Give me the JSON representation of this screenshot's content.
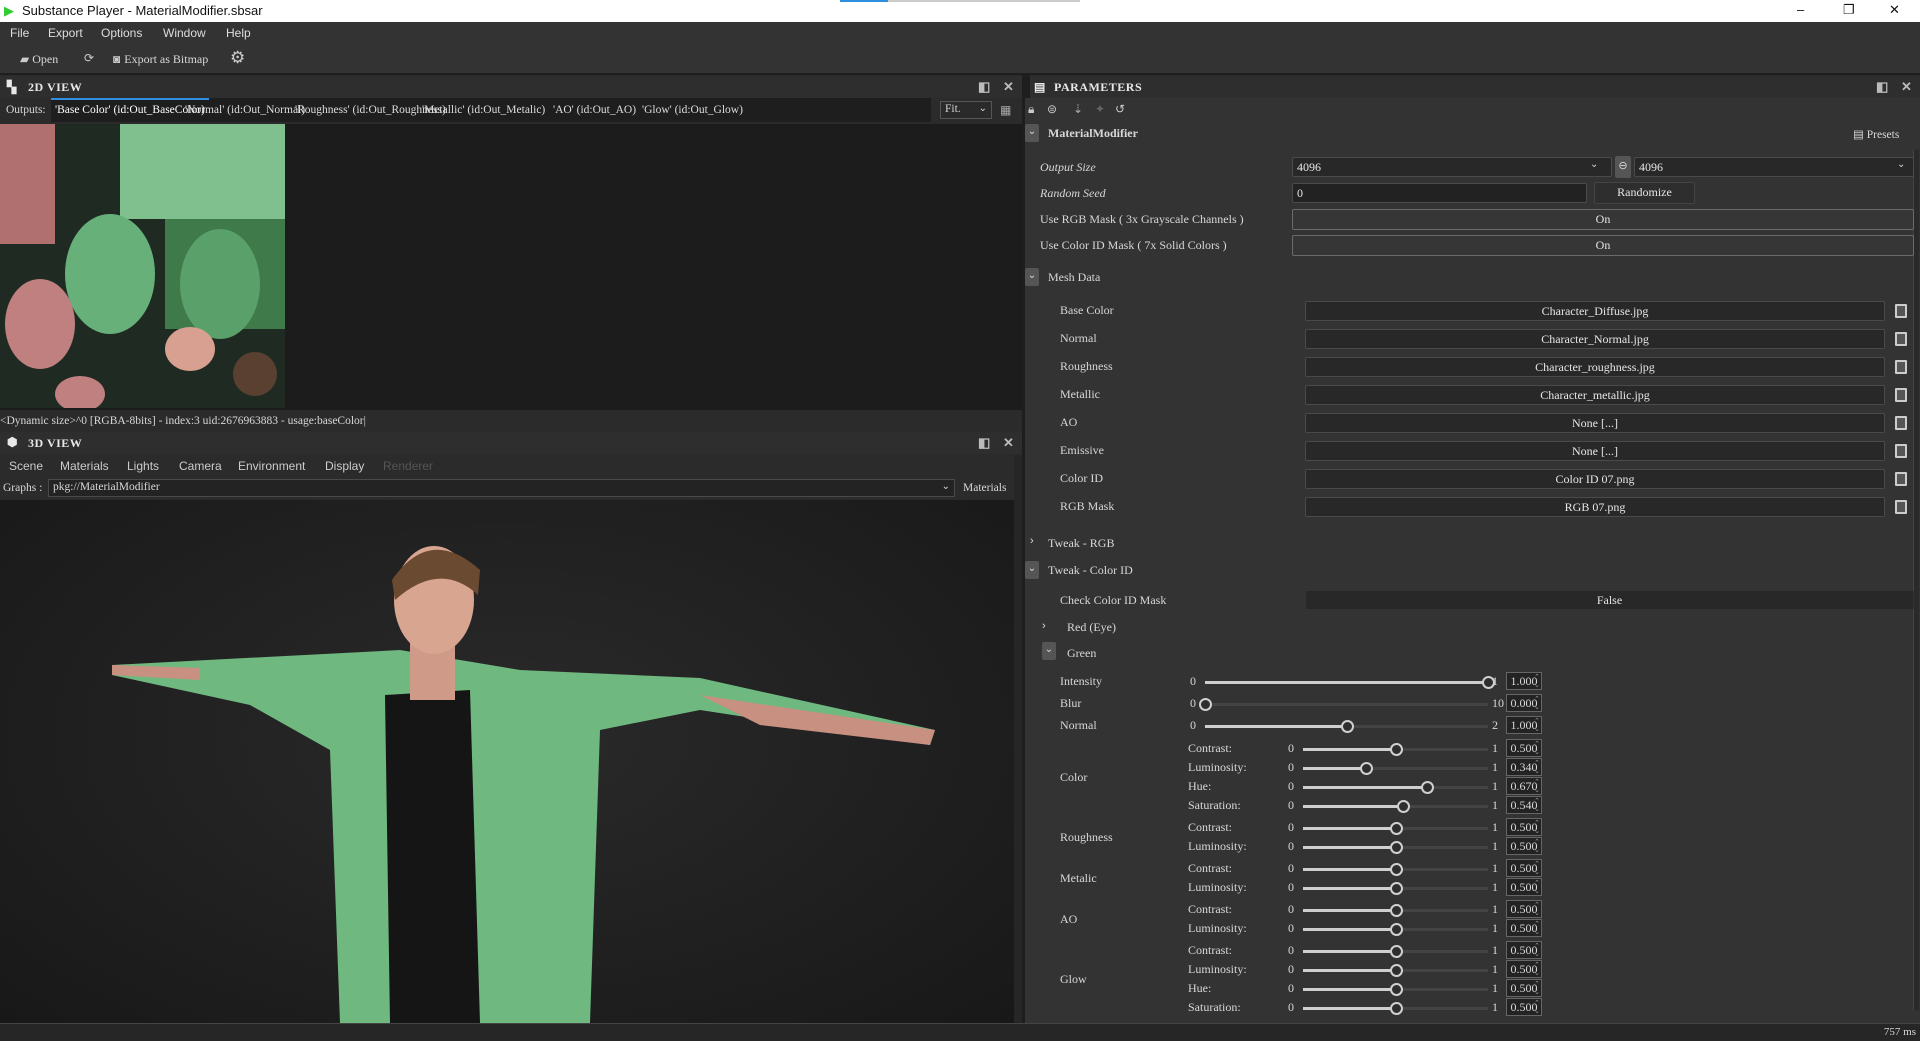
{
  "window": {
    "title": "Substance Player - MaterialModifier.sbsar",
    "minimize": "–",
    "maximize": "❐",
    "close": "✕"
  },
  "menu": [
    "File",
    "Export",
    "Options",
    "Window",
    "Help"
  ],
  "toolbar": {
    "open": "Open",
    "export": "Export as Bitmap"
  },
  "view2d": {
    "title": "2D VIEW",
    "outputs_label": "Outputs:",
    "tabs": [
      "'Base Color' (id:Out_BaseColor)",
      "'Normal' (id:Out_Normal)",
      "'Roughness' (id:Out_Roughness)",
      "'Metallic' (id:Out_Metalic)",
      "'AO' (id:Out_AO)",
      "'Glow' (id:Out_Glow)"
    ],
    "active_tab": 0,
    "zoom": "Fit.",
    "status": "<Dynamic size>^0 [RGBA-8bits] - index:3 uid:2676963883 - usage:baseColor|"
  },
  "view3d": {
    "title": "3D VIEW",
    "tabs": [
      "Scene",
      "Materials",
      "Lights",
      "Camera",
      "Environment",
      "Display",
      "Renderer"
    ],
    "graphs_label": "Graphs :",
    "graph": "pkg://MaterialModifier",
    "materials": "Materials"
  },
  "status": {
    "time": "757 ms"
  },
  "params": {
    "title": "PARAMETERS",
    "graph": "MaterialModifier",
    "presets": "Presets",
    "output_size_label": "Output Size",
    "output_w": "4096",
    "output_h": "4096",
    "seed_label": "Random Seed",
    "seed": "0",
    "randomize": "Randomize",
    "rgb_mask_label": "Use RGB Mask ( 3x Grayscale Channels )",
    "rgb_mask": "On",
    "colorid_mask_label": "Use Color ID Mask ( 7x Solid Colors )",
    "colorid_mask": "On",
    "mesh_group": "Mesh Data",
    "mesh": [
      {
        "label": "Base Color",
        "value": "Character_Diffuse.jpg"
      },
      {
        "label": "Normal",
        "value": "Character_Normal.jpg"
      },
      {
        "label": "Roughness",
        "value": "Character_roughness.jpg"
      },
      {
        "label": "Metallic",
        "value": "Character_metallic.jpg"
      },
      {
        "label": "AO",
        "value": "None [...]"
      },
      {
        "label": "Emissive",
        "value": "None [...]"
      },
      {
        "label": "Color ID",
        "value": "Color ID 07.png"
      },
      {
        "label": "RGB Mask",
        "value": "RGB 07.png"
      }
    ],
    "tweak_rgb": "Tweak - RGB",
    "tweak_colorid": "Tweak - Color ID",
    "check_label": "Check Color ID Mask",
    "check_value": "False",
    "red_group": "Red (Eye)",
    "green_group": "Green",
    "main_sliders": [
      {
        "label": "Intensity",
        "min": "0",
        "max": "1",
        "value": "1.000",
        "frac": 1.0
      },
      {
        "label": "Blur",
        "min": "0",
        "max": "10",
        "value": "0.000",
        "frac": 0.0
      },
      {
        "label": "Normal",
        "min": "0",
        "max": "2",
        "value": "1.000",
        "frac": 0.5
      }
    ],
    "groups": [
      {
        "label": "Color",
        "sliders": [
          {
            "label": "Contrast:",
            "value": "0.500",
            "frac": 0.5
          },
          {
            "label": "Luminosity:",
            "value": "0.340",
            "frac": 0.34
          },
          {
            "label": "Hue:",
            "value": "0.670",
            "frac": 0.67
          },
          {
            "label": "Saturation:",
            "value": "0.540",
            "frac": 0.54
          }
        ]
      },
      {
        "label": "Roughness",
        "sliders": [
          {
            "label": "Contrast:",
            "value": "0.500",
            "frac": 0.5
          },
          {
            "label": "Luminosity:",
            "value": "0.500",
            "frac": 0.5
          }
        ]
      },
      {
        "label": "Metalic",
        "sliders": [
          {
            "label": "Contrast:",
            "value": "0.500",
            "frac": 0.5
          },
          {
            "label": "Luminosity:",
            "value": "0.500",
            "frac": 0.5
          }
        ]
      },
      {
        "label": "AO",
        "sliders": [
          {
            "label": "Contrast:",
            "value": "0.500",
            "frac": 0.5
          },
          {
            "label": "Luminosity:",
            "value": "0.500",
            "frac": 0.5
          }
        ]
      },
      {
        "label": "Glow",
        "sliders": [
          {
            "label": "Contrast:",
            "value": "0.500",
            "frac": 0.5
          },
          {
            "label": "Luminosity:",
            "value": "0.500",
            "frac": 0.5
          },
          {
            "label": "Hue:",
            "value": "0.500",
            "frac": 0.5
          },
          {
            "label": "Saturation:",
            "value": "0.500",
            "frac": 0.5
          }
        ]
      }
    ],
    "sub_min": "0",
    "sub_max": "1"
  },
  "colors": {
    "accent": "#2f8fe0",
    "jacket": "#6fb87f",
    "panel": "#333333"
  }
}
